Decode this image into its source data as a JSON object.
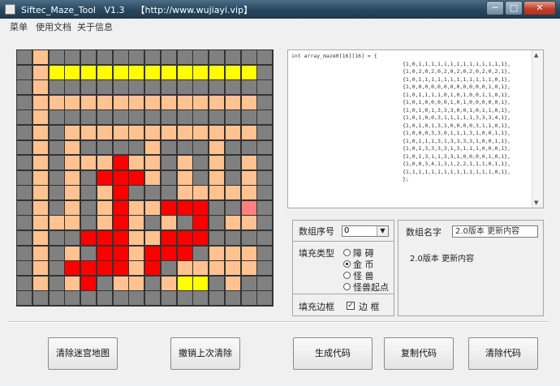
{
  "window": {
    "title": "Siftec_Maze_Tool   V1.3    【http://www.wujiayi.vip】",
    "min_label": "─",
    "max_label": "□",
    "close_label": "✕"
  },
  "menu": {
    "items": [
      "菜单",
      "使用文档",
      "关于信息"
    ]
  },
  "maze": {
    "colors": {
      "0": "#808080",
      "1": "#ffc290",
      "2": "#ffff00",
      "3": "#ff0000",
      "4": "#ff8080"
    },
    "grid": [
      "0100000000000000",
      "0122222222222220",
      "0100000000000000",
      "0111111111111110",
      "0100000000000000",
      "0101111111111110",
      "0101000010001000",
      "0101113110101010",
      "0101033310101010",
      "0101013000111110",
      "0101013113330040",
      "0111013101030110",
      "0100333113330000",
      "0101033133301110",
      "0103333130111110",
      "0101301101220100",
      "0000000000000000"
    ]
  },
  "code": {
    "lines": [
      "int array_maze0[16][16] = {",
      "                                   {1,0,1,1,1,1,1,1,1,1,1,1,1,1,1,1},",
      "                                   {1,0,2,0,2,0,2,0,2,0,2,0,2,0,2,1},",
      "                                   {1,0,1,1,1,1,1,1,1,1,1,1,1,1,0,1},",
      "                                   {1,0,0,0,0,0,0,0,0,0,0,0,0,1,0,1},",
      "                                   {1,0,1,1,1,1,0,1,0,1,0,0,1,1,0,1},",
      "                                   {1,0,1,0,0,0,0,1,0,1,0,0,0,0,0,1},",
      "                                   {1,0,1,0,1,3,3,3,0,0,1,0,1,1,0,1},",
      "                                   {1,0,1,0,0,3,1,1,1,1,1,3,3,3,4,1},",
      "                                   {1,0,1,0,1,3,1,0,0,0,0,3,1,1,0,1},",
      "                                   {1,0,0,0,3,3,0,1,1,1,3,1,0,0,1,1},",
      "                                   {1,0,1,1,1,3,1,3,3,3,3,1,0,0,1,1},",
      "                                   {1,0,1,3,3,3,3,1,3,1,1,1,0,0,0,1},",
      "                                   {1,0,1,3,1,1,3,3,1,0,0,0,0,1,0,1},",
      "                                   {1,0,0,3,4,1,3,1,2,2,1,1,1,0,1,1},",
      "                                   {1,1,1,1,1,1,1,1,1,1,1,1,1,1,0,1},",
      "                                   };"
    ]
  },
  "panel": {
    "array_index_label": "数组序号",
    "array_index_value": "0",
    "fill_type_label": "填充类型",
    "fill_options": [
      "障  碍",
      "金  币",
      "怪  兽",
      "怪兽起点"
    ],
    "fill_selected": 1,
    "fill_border_label": "填充边框",
    "border_checkbox_label": "边  框",
    "border_checked": true,
    "check_mark": "✓",
    "array_name_label": "数组名字",
    "array_name_value": "2.0版本 更新内容",
    "array_name_display": "2.0版本 更新内容"
  },
  "buttons": {
    "clear_maze": "清除迷宫地图",
    "undo_clear": "撤销上次清除",
    "generate_code": "生成代码",
    "copy_code": "复制代码",
    "clear_code": "清除代码"
  }
}
